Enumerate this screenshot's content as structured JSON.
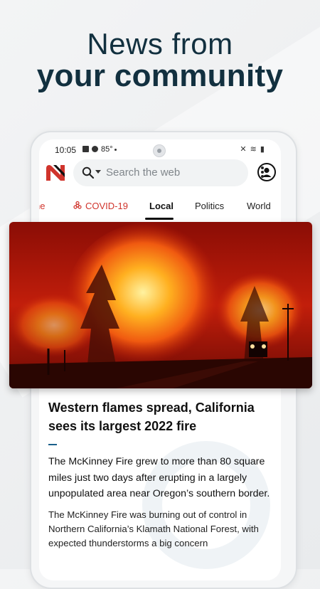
{
  "promo": {
    "line1": "News from",
    "line2": "your community"
  },
  "statusbar": {
    "time": "10:05",
    "temp": "85°"
  },
  "search": {
    "placeholder": "Search the web"
  },
  "tabs": [
    {
      "label": "ne"
    },
    {
      "label": "COVID-19"
    },
    {
      "label": "Local"
    },
    {
      "label": "Politics"
    },
    {
      "label": "World"
    }
  ],
  "article": {
    "title": "Western flames spread, California sees its largest 2022 fire",
    "summary": "The McKinney Fire grew to more than 80 square miles just two days after erupting in a largely unpopulated area near Oregon’s southern border.",
    "body": "The McKinney Fire was burning out of control in Northern California’s Klamath National Forest, with expected thunderstorms a big concern"
  },
  "colors": {
    "brand_red": "#d0342c",
    "headline": "#12303f"
  }
}
